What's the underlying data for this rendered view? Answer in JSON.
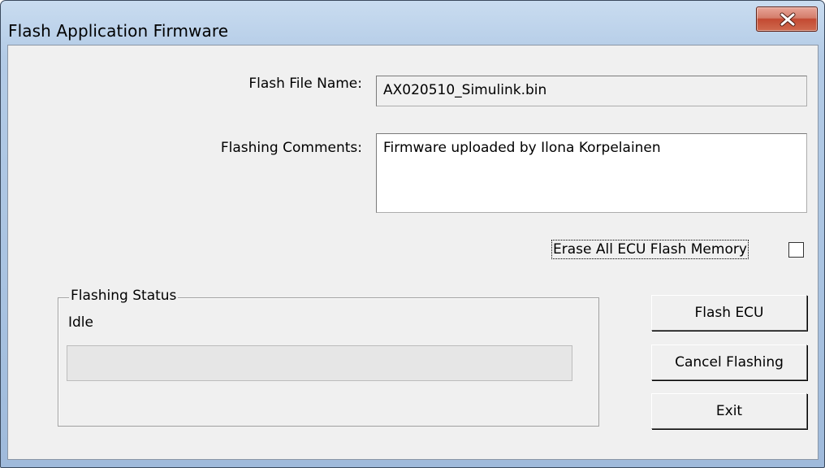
{
  "window": {
    "title": "Flash Application Firmware"
  },
  "form": {
    "flash_file_label": "Flash File Name:",
    "flash_file_value": "AX020510_Simulink.bin",
    "comments_label": "Flashing Comments:",
    "comments_value": "Firmware uploaded by Ilona Korpelainen",
    "erase_label": "Erase All ECU Flash Memory",
    "erase_checked": false
  },
  "status": {
    "group_title": "Flashing Status",
    "state": "Idle",
    "progress": 0
  },
  "buttons": {
    "flash": "Flash ECU",
    "cancel": "Cancel Flashing",
    "exit": "Exit"
  },
  "icons": {
    "close": "close-x-icon"
  },
  "colors": {
    "close_button": "#c34a32",
    "title_bar": "#b3cbe6",
    "dialog_bg": "#f0f0f0"
  }
}
